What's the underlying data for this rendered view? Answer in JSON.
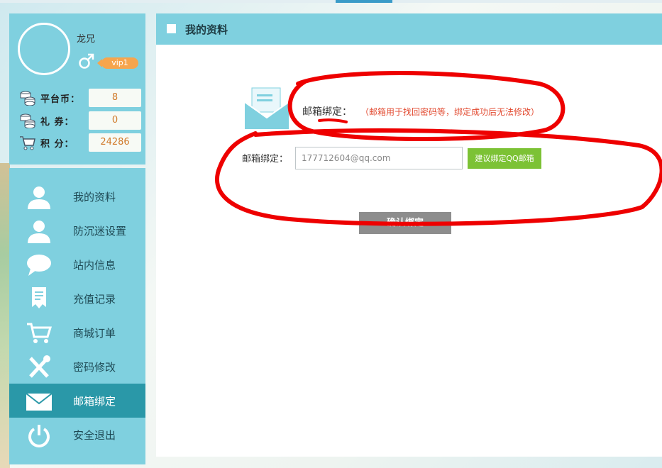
{
  "user": {
    "username": "龙兄",
    "vip": "vip1",
    "stats": [
      {
        "icon": "coins-icon",
        "label": "平台币：",
        "value": "8"
      },
      {
        "icon": "coupon-icon",
        "label": "礼  券：",
        "value": "0"
      },
      {
        "icon": "cart-icon",
        "label": "积  分：",
        "value": "24286"
      }
    ]
  },
  "nav": {
    "items": [
      {
        "label": "我的资料",
        "icon": "user-icon"
      },
      {
        "label": "防沉迷设置",
        "icon": "user-icon"
      },
      {
        "label": "站内信息",
        "icon": "chat-bubble-icon"
      },
      {
        "label": "充值记录",
        "icon": "document-icon"
      },
      {
        "label": "商城订单",
        "icon": "cart-icon"
      },
      {
        "label": "密码修改",
        "icon": "tools-icon"
      },
      {
        "label": "邮箱绑定",
        "icon": "mail-icon",
        "active": true
      },
      {
        "label": "安全退出",
        "icon": "power-icon"
      }
    ]
  },
  "main": {
    "title": "我的资料",
    "bind_title": "邮箱绑定：",
    "bind_note": "（邮箱用于找回密码等，绑定成功后无法修改）",
    "email_label": "邮箱绑定：",
    "email_value": "177712604@qq.com",
    "qq_button": "建议绑定QQ邮箱",
    "confirm_button": "确认绑定"
  },
  "colors": {
    "panel": "#7fd0df",
    "active": "#2a98a8",
    "note_red": "#e2492f",
    "qq_green": "#7cc235",
    "annotation": "#ee0000"
  }
}
